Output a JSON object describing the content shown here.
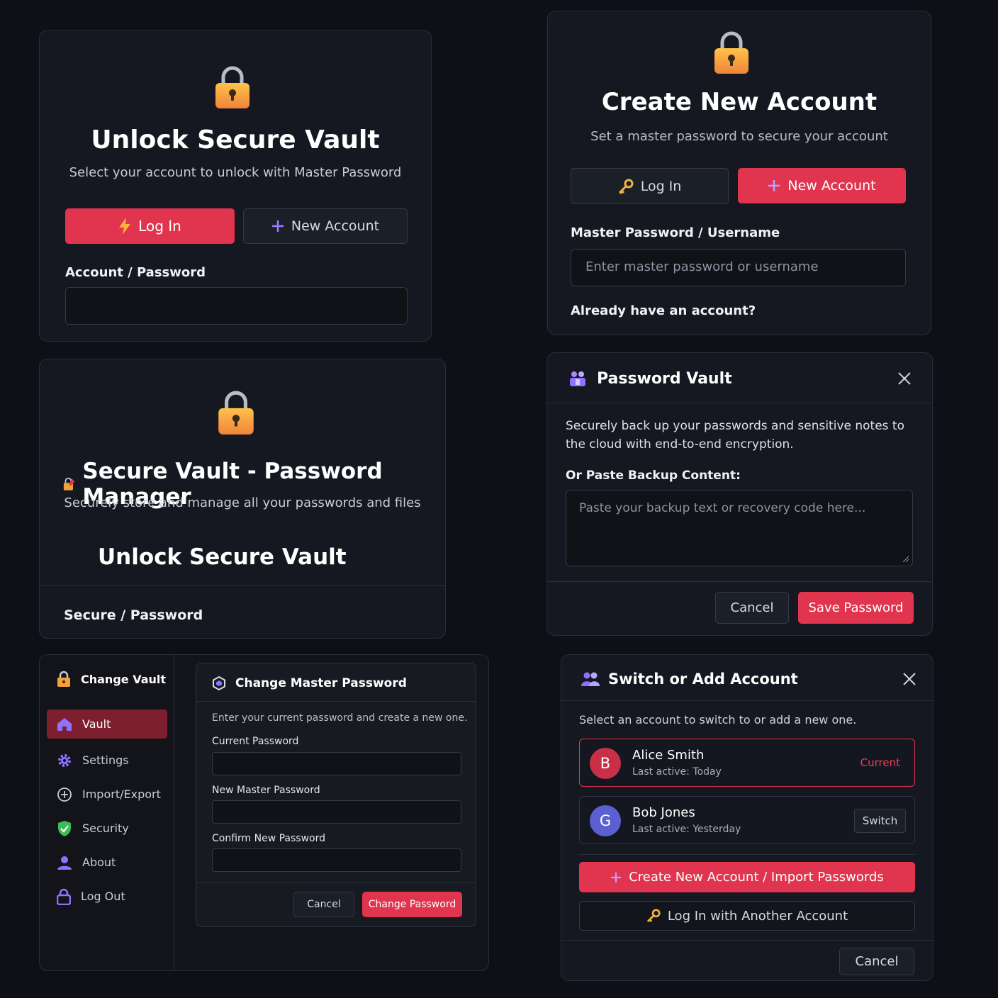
{
  "colors": {
    "accent": "#e0344f",
    "lock_orange": "#f39a3b",
    "purple": "#9b7bff",
    "avatar_bob": "#5a5fd1"
  },
  "unlock_panel": {
    "title": "Unlock Secure Vault",
    "subtitle": "Select your account to unlock with Master Password",
    "login_label": "Log In",
    "login_icon": "lightning-icon",
    "new_account_label": "New Account",
    "new_account_icon": "plus-icon",
    "field_label": "Account / Password",
    "field_value": ""
  },
  "create_panel": {
    "title": "Create New Account",
    "subtitle": "Set a master password to secure your account",
    "login_label": "Log In",
    "login_icon": "key-icon",
    "new_account_label": "New Account",
    "field_label": "Master Password / Username",
    "field_placeholder": "Enter master password or username",
    "footer_text": "Already have an account?"
  },
  "manager_panel": {
    "title": "Secure Vault - Password Manager",
    "subtitle": "Securely store and manage all your passwords and files",
    "heading": "Unlock Secure Vault",
    "field_label": "Secure / Password"
  },
  "vault_modal": {
    "title": "Password Vault",
    "description": "Securely back up your passwords and sensitive notes to the cloud with end-to-end encryption.",
    "paste_label": "Or Paste Backup Content:",
    "paste_placeholder": "Paste your backup text or recovery code here...",
    "cancel_label": "Cancel",
    "save_label": "Save Password"
  },
  "settings_view": {
    "sidebar_title": "Change Vault",
    "items": [
      {
        "label": "Vault",
        "icon": "home-icon",
        "active": true
      },
      {
        "label": "Settings",
        "icon": "gear-icon"
      },
      {
        "label": "Import/Export",
        "icon": "import-export-icon"
      },
      {
        "label": "Security",
        "icon": "shield-check-icon"
      },
      {
        "label": "About",
        "icon": "user-icon"
      },
      {
        "label": "Log Out",
        "icon": "logout-lock-icon"
      }
    ],
    "modal": {
      "title": "Change Master Password",
      "description": "Enter your current password and create a new one.",
      "current_label": "Current Password",
      "new_label": "New Master Password",
      "confirm_label": "Confirm New Password",
      "cancel_label": "Cancel",
      "change_label": "Change Password"
    }
  },
  "switch_modal": {
    "title": "Switch or Add Account",
    "description": "Select an account to switch to or add a new one.",
    "accounts": [
      {
        "initial": "B",
        "name": "Alice Smith",
        "last_active": "Last active: Today",
        "status": "Current"
      },
      {
        "initial": "G",
        "name": "Bob Jones",
        "last_active": "Last active: Yesterday",
        "action": "Switch"
      }
    ],
    "create_label": "Create New Account / Import Passwords",
    "login_label": "Log In with Another Account",
    "cancel_label": "Cancel"
  }
}
